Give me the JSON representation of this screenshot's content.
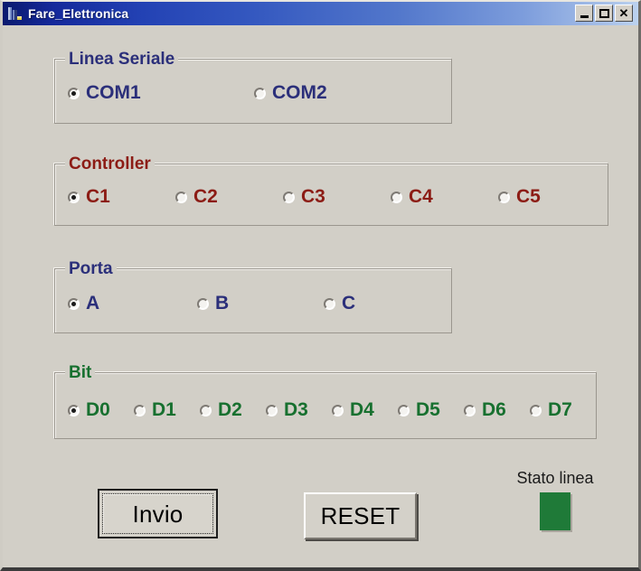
{
  "window": {
    "title": "Fare_Elettronica",
    "icon": "vb-app-icon",
    "controls": {
      "minimize": "_",
      "maximize": "□",
      "close": "✕"
    }
  },
  "groups": {
    "serial": {
      "title": "Linea Seriale",
      "title_color": "#2b2f7a",
      "options": [
        {
          "label": "COM1",
          "checked": true
        },
        {
          "label": "COM2",
          "checked": false
        }
      ]
    },
    "controller": {
      "title": "Controller",
      "title_color": "#8c1c15",
      "options": [
        {
          "label": "C1",
          "checked": true
        },
        {
          "label": "C2",
          "checked": false
        },
        {
          "label": "C3",
          "checked": false
        },
        {
          "label": "C4",
          "checked": false
        },
        {
          "label": "C5",
          "checked": false
        }
      ]
    },
    "porta": {
      "title": "Porta",
      "title_color": "#2b2f7a",
      "options": [
        {
          "label": "A",
          "checked": true
        },
        {
          "label": "B",
          "checked": false
        },
        {
          "label": "C",
          "checked": false
        }
      ]
    },
    "bit": {
      "title": "Bit",
      "title_color": "#17702f",
      "options": [
        {
          "label": "D0",
          "checked": true
        },
        {
          "label": "D1",
          "checked": false
        },
        {
          "label": "D2",
          "checked": false
        },
        {
          "label": "D3",
          "checked": false
        },
        {
          "label": "D4",
          "checked": false
        },
        {
          "label": "D5",
          "checked": false
        },
        {
          "label": "D6",
          "checked": false
        },
        {
          "label": "D7",
          "checked": false
        }
      ]
    }
  },
  "buttons": {
    "send": "Invio",
    "reset": "RESET"
  },
  "status": {
    "caption": "Stato linea",
    "led_color": "#1f7a38",
    "led_state": "on"
  }
}
